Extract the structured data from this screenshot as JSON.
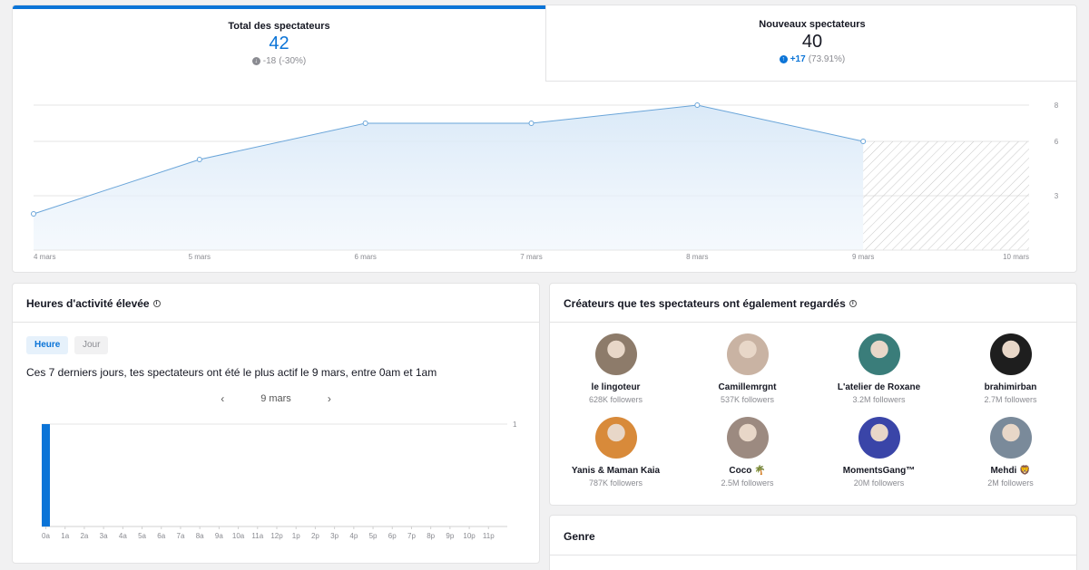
{
  "tabs": {
    "total": {
      "title": "Total des spectateurs",
      "value": "42",
      "change": "-18",
      "change_pct": "(-30%)"
    },
    "new": {
      "title": "Nouveaux spectateurs",
      "value": "40",
      "change": "+17",
      "change_pct": "(73.91%)"
    }
  },
  "chart_data": [
    {
      "type": "area",
      "x": [
        "4 mars",
        "5 mars",
        "6 mars",
        "7 mars",
        "8 mars",
        "9 mars",
        "10 mars"
      ],
      "values": [
        2,
        5,
        7,
        7,
        8,
        6,
        null
      ],
      "yticks": [
        3,
        6,
        8
      ],
      "ylim": [
        0,
        9
      ],
      "projected_from": "9 mars",
      "color": "#6aa5d9",
      "grid": true
    },
    {
      "type": "bar",
      "categories": [
        "0a",
        "1a",
        "2a",
        "3a",
        "4a",
        "5a",
        "6a",
        "7a",
        "8a",
        "9a",
        "10a",
        "11a",
        "12p",
        "1p",
        "2p",
        "3p",
        "4p",
        "5p",
        "6p",
        "7p",
        "8p",
        "9p",
        "10p",
        "11p"
      ],
      "values": [
        1,
        0,
        0,
        0,
        0,
        0,
        0,
        0,
        0,
        0,
        0,
        0,
        0,
        0,
        0,
        0,
        0,
        0,
        0,
        0,
        0,
        0,
        0,
        0
      ],
      "yticks": [
        1
      ],
      "ylim": [
        0,
        1
      ],
      "color": "#0b74d7"
    }
  ],
  "hours": {
    "title": "Heures d'activité élevée",
    "tab_hour": "Heure",
    "tab_day": "Jour",
    "description": "Ces 7 derniers jours, tes spectateurs ont été le plus actif le 9 mars, entre 0am et 1am",
    "date": "9 mars",
    "prev": "‹",
    "next": "›"
  },
  "creators": {
    "title": "Créateurs que tes spectateurs ont également regardés",
    "items": [
      {
        "name": "le lingoteur",
        "followers": "628K followers",
        "avatar_color": "#8d7b6a"
      },
      {
        "name": "Camillemrgnt",
        "followers": "537K followers",
        "avatar_color": "#c9b3a3"
      },
      {
        "name": "L'atelier de Roxane",
        "followers": "3.2M followers",
        "avatar_color": "#3a7d7a"
      },
      {
        "name": "brahimirban",
        "followers": "2.7M followers",
        "avatar_color": "#1e1e1e"
      },
      {
        "name": "Yanis & Maman Kaia",
        "followers": "787K followers",
        "avatar_color": "#d88a3a"
      },
      {
        "name": "Coco 🌴",
        "followers": "2.5M followers",
        "avatar_color": "#9c8a80"
      },
      {
        "name": "MomentsGang™",
        "followers": "20M followers",
        "avatar_color": "#3a45a8"
      },
      {
        "name": "Mehdi 🦁",
        "followers": "2M followers",
        "avatar_color": "#7a8a9a"
      }
    ]
  },
  "genre": {
    "title": "Genre"
  }
}
